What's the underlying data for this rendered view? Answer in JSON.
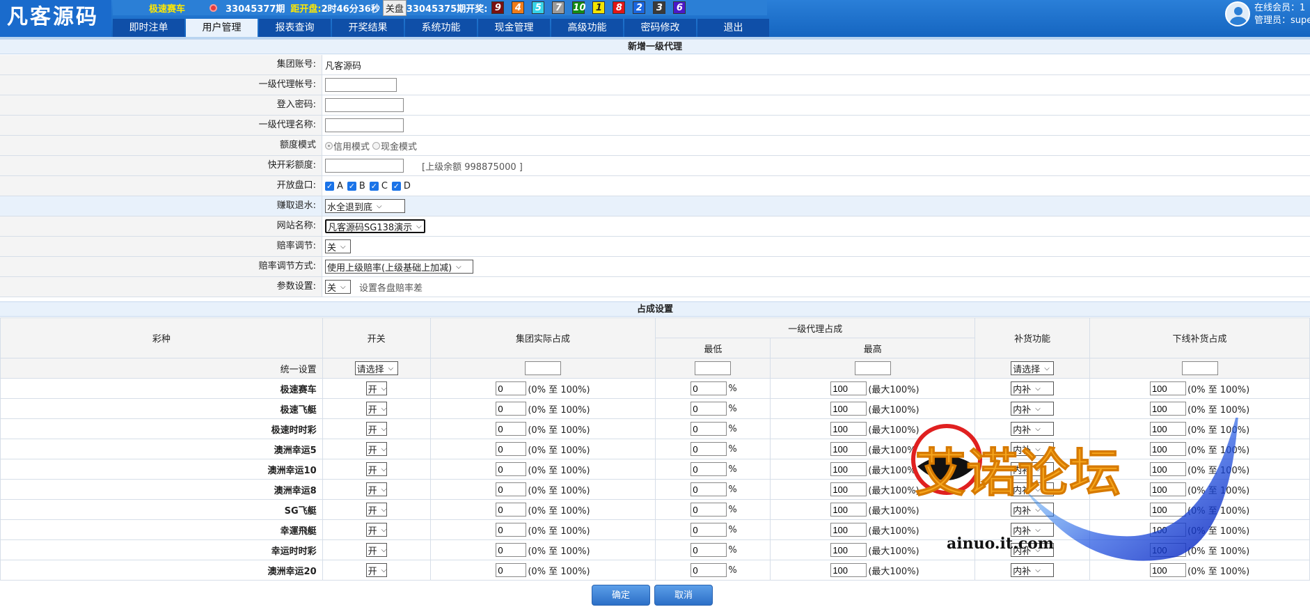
{
  "header": {
    "logo": "凡客源码",
    "game": "极速赛车",
    "issue": "33045377期",
    "countdown_label": "距开盘:",
    "countdown": "2时46分36秒",
    "close_label": "关盘",
    "last_issue": "33045375期开奖:",
    "balls": [
      {
        "n": "9",
        "color": "#7a1010"
      },
      {
        "n": "4",
        "color": "#f07c1a"
      },
      {
        "n": "5",
        "color": "#37d3e8"
      },
      {
        "n": "7",
        "color": "#9b9b9b"
      },
      {
        "n": "10",
        "color": "#148c14"
      },
      {
        "n": "1",
        "color": "#f3e500"
      },
      {
        "n": "8",
        "color": "#e01616"
      },
      {
        "n": "2",
        "color": "#1a66e0"
      },
      {
        "n": "3",
        "color": "#3a3a3a"
      },
      {
        "n": "6",
        "color": "#4b18c9"
      }
    ],
    "nav": [
      "即时注单",
      "用户管理",
      "报表查询",
      "开奖结果",
      "系统功能",
      "现金管理",
      "高级功能",
      "密码修改",
      "退出"
    ],
    "nav_active": 1,
    "online": "在线会员：1",
    "admin": "管理员：supe"
  },
  "form": {
    "title": "新增一级代理",
    "group_account_label": "集团账号:",
    "group_account": "凡客源码",
    "agent_account_label": "一级代理帐号:",
    "password_label": "登入密码:",
    "agent_name_label": "一级代理名称:",
    "credit_mode_label": "额度模式",
    "credit_option": "信用模式",
    "cash_option": "现金模式",
    "quota_label": "快开彩额度:",
    "balance_note": "[上级余额 998875000 ]",
    "market_label": "开放盘口:",
    "markets": [
      "A",
      "B",
      "C",
      "D"
    ],
    "rebate_label": "赚取退水:",
    "rebate_value": "水全退到底",
    "site_label": "网站名称:",
    "site_value": "凡客源码SG138演示",
    "odds_adjust_label": "赔率调节:",
    "odds_adjust_value": "关",
    "odds_method_label": "赔率调节方式:",
    "odds_method_value": "使用上级赔率(上级基础上加减)",
    "param_label": "参数设置:",
    "param_value": "关",
    "param_note": "设置各盘赔率差"
  },
  "share": {
    "title": "占成设置",
    "headers": {
      "lottery": "彩种",
      "switch": "开关",
      "group_actual": "集团实际占成",
      "agent_share": "一级代理占成",
      "min": "最低",
      "max": "最高",
      "replenish": "补货功能",
      "sub_replenish": "下线补货占成"
    },
    "unified_label": "统一设置",
    "select_placeholder": "请选择",
    "range_text": "(0% 至 100%)",
    "max_text": "(最大100%)",
    "pct": "%",
    "rows": [
      {
        "name": "极速赛车",
        "switch": "开",
        "group": "0",
        "min": "0",
        "max": "100",
        "replenish": "内补",
        "sub": "100"
      },
      {
        "name": "极速飞艇",
        "switch": "开",
        "group": "0",
        "min": "0",
        "max": "100",
        "replenish": "内补",
        "sub": "100"
      },
      {
        "name": "极速时时彩",
        "switch": "开",
        "group": "0",
        "min": "0",
        "max": "100",
        "replenish": "内补",
        "sub": "100"
      },
      {
        "name": "澳洲幸运5",
        "switch": "开",
        "group": "0",
        "min": "0",
        "max": "100",
        "replenish": "内补",
        "sub": "100"
      },
      {
        "name": "澳洲幸运10",
        "switch": "开",
        "group": "0",
        "min": "0",
        "max": "100",
        "replenish": "内补",
        "sub": "100"
      },
      {
        "name": "澳洲幸运8",
        "switch": "开",
        "group": "0",
        "min": "0",
        "max": "100",
        "replenish": "内补",
        "sub": "100"
      },
      {
        "name": "SG飞艇",
        "switch": "开",
        "group": "0",
        "min": "0",
        "max": "100",
        "replenish": "内补",
        "sub": "100"
      },
      {
        "name": "幸運飛艇",
        "switch": "开",
        "group": "0",
        "min": "0",
        "max": "100",
        "replenish": "内补",
        "sub": "100"
      },
      {
        "name": "幸运时时彩",
        "switch": "开",
        "group": "0",
        "min": "0",
        "max": "100",
        "replenish": "内补",
        "sub": "100"
      },
      {
        "name": "澳洲幸运20",
        "switch": "开",
        "group": "0",
        "min": "0",
        "max": "100",
        "replenish": "内补",
        "sub": "100"
      }
    ]
  },
  "buttons": {
    "confirm": "确定",
    "cancel": "取消"
  },
  "watermark": {
    "text": "艾诺论坛",
    "url": "ainuo.it.com"
  }
}
